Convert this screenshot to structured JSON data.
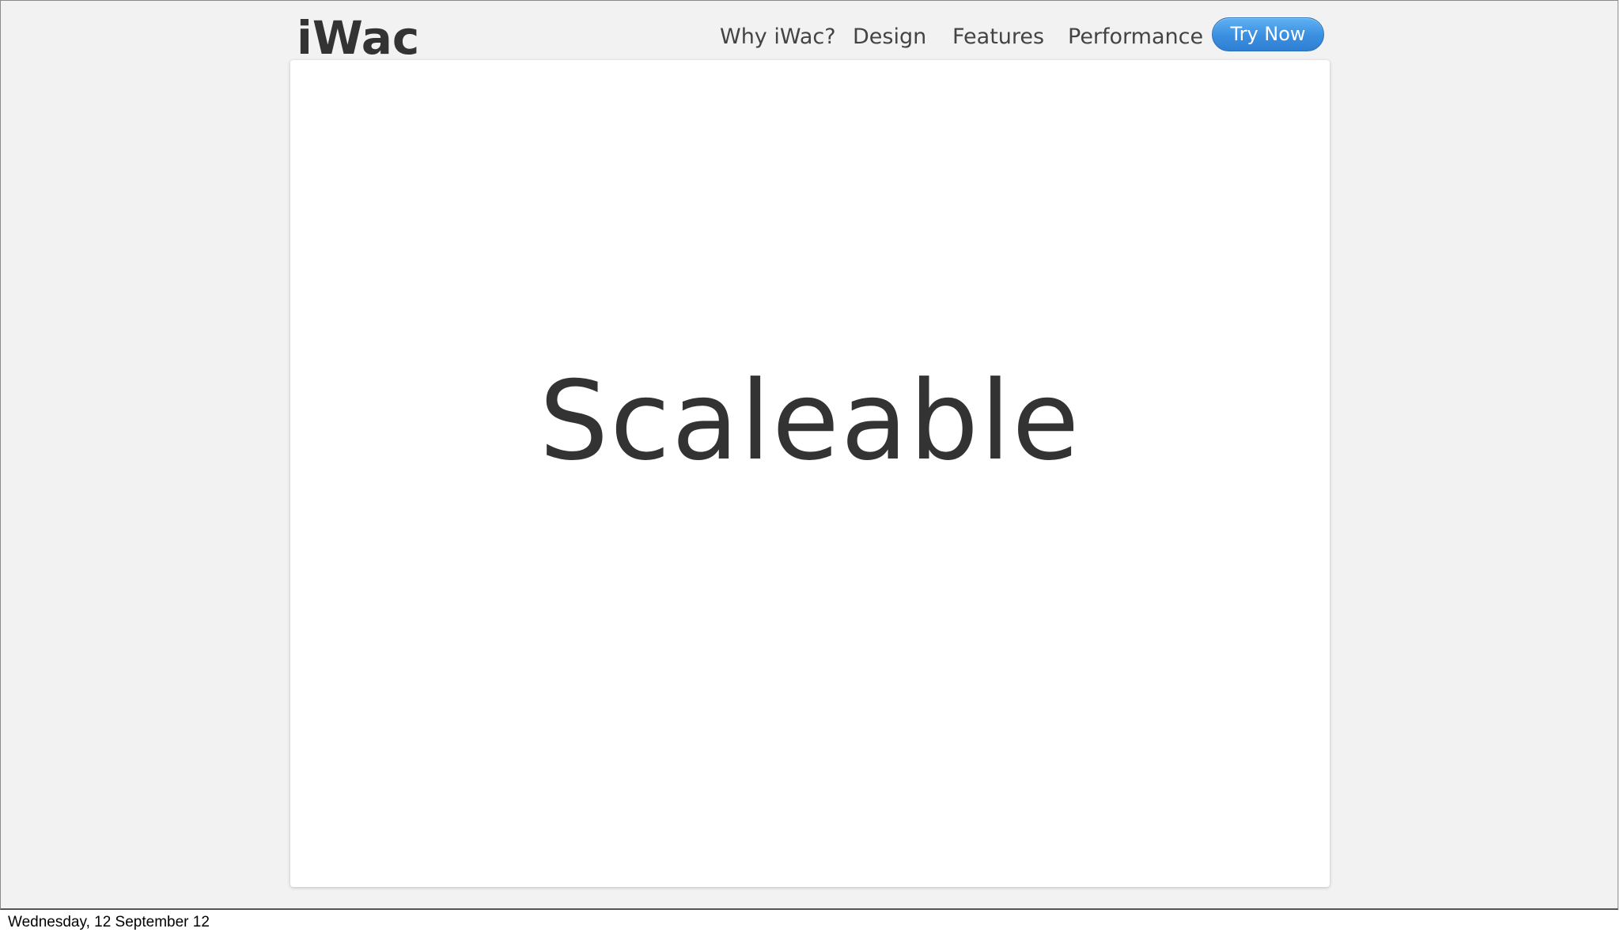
{
  "header": {
    "logo": "iWac",
    "nav": [
      "Why iWac?",
      "Design",
      "Features",
      "Performance"
    ],
    "cta_label": "Try Now"
  },
  "main": {
    "headline": "Scaleable"
  },
  "footer": {
    "date": "Wednesday, 12 September 12"
  },
  "colors": {
    "background": "#f3f2f2",
    "text": "#333333",
    "cta": "#3a8fe0"
  }
}
